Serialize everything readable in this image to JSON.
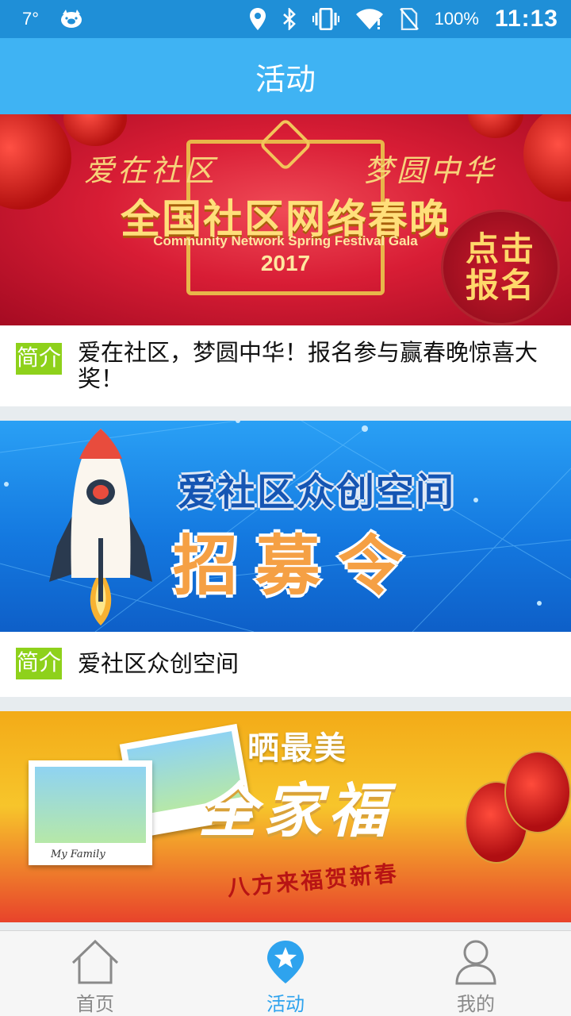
{
  "status_bar": {
    "temperature": "7°",
    "battery": "100%",
    "time": "11:13",
    "icons": [
      "weather-pig-icon",
      "location-icon",
      "bluetooth-icon",
      "vibrate-icon",
      "wifi-icon",
      "no-sim-icon"
    ]
  },
  "header": {
    "title": "活动"
  },
  "cards": [
    {
      "tag": "简介",
      "description": "爱在社区，梦圆中华！报名参与赢春晚惊喜大奖！",
      "banner": {
        "slogan_left": "爱在社区",
        "slogan_right": "梦圆中华",
        "title": "全国社区网络春晚",
        "subtitle": "Community Network Spring Festival Gala",
        "year": "2017",
        "badge_line1": "点击",
        "badge_line2": "报名"
      }
    },
    {
      "tag": "简介",
      "description": "爱社区众创空间",
      "banner": {
        "title": "爱社区众创空间",
        "subtitle": "招募令"
      }
    },
    {
      "banner": {
        "top": "晒最美",
        "title": "全家福",
        "subtitle": "八方来福贺新春",
        "photo_caption": "My Family"
      }
    }
  ],
  "bottom_nav": {
    "items": [
      {
        "label": "首页",
        "icon": "home-icon",
        "active": false
      },
      {
        "label": "活动",
        "icon": "star-pin-icon",
        "active": true
      },
      {
        "label": "我的",
        "icon": "person-icon",
        "active": false
      }
    ]
  },
  "colors": {
    "status_bar": "#1f8fd7",
    "header": "#3fb3f3",
    "tag": "#8ed11b",
    "nav_active": "#2ea3ee",
    "nav_inactive": "#8a8a8a"
  }
}
